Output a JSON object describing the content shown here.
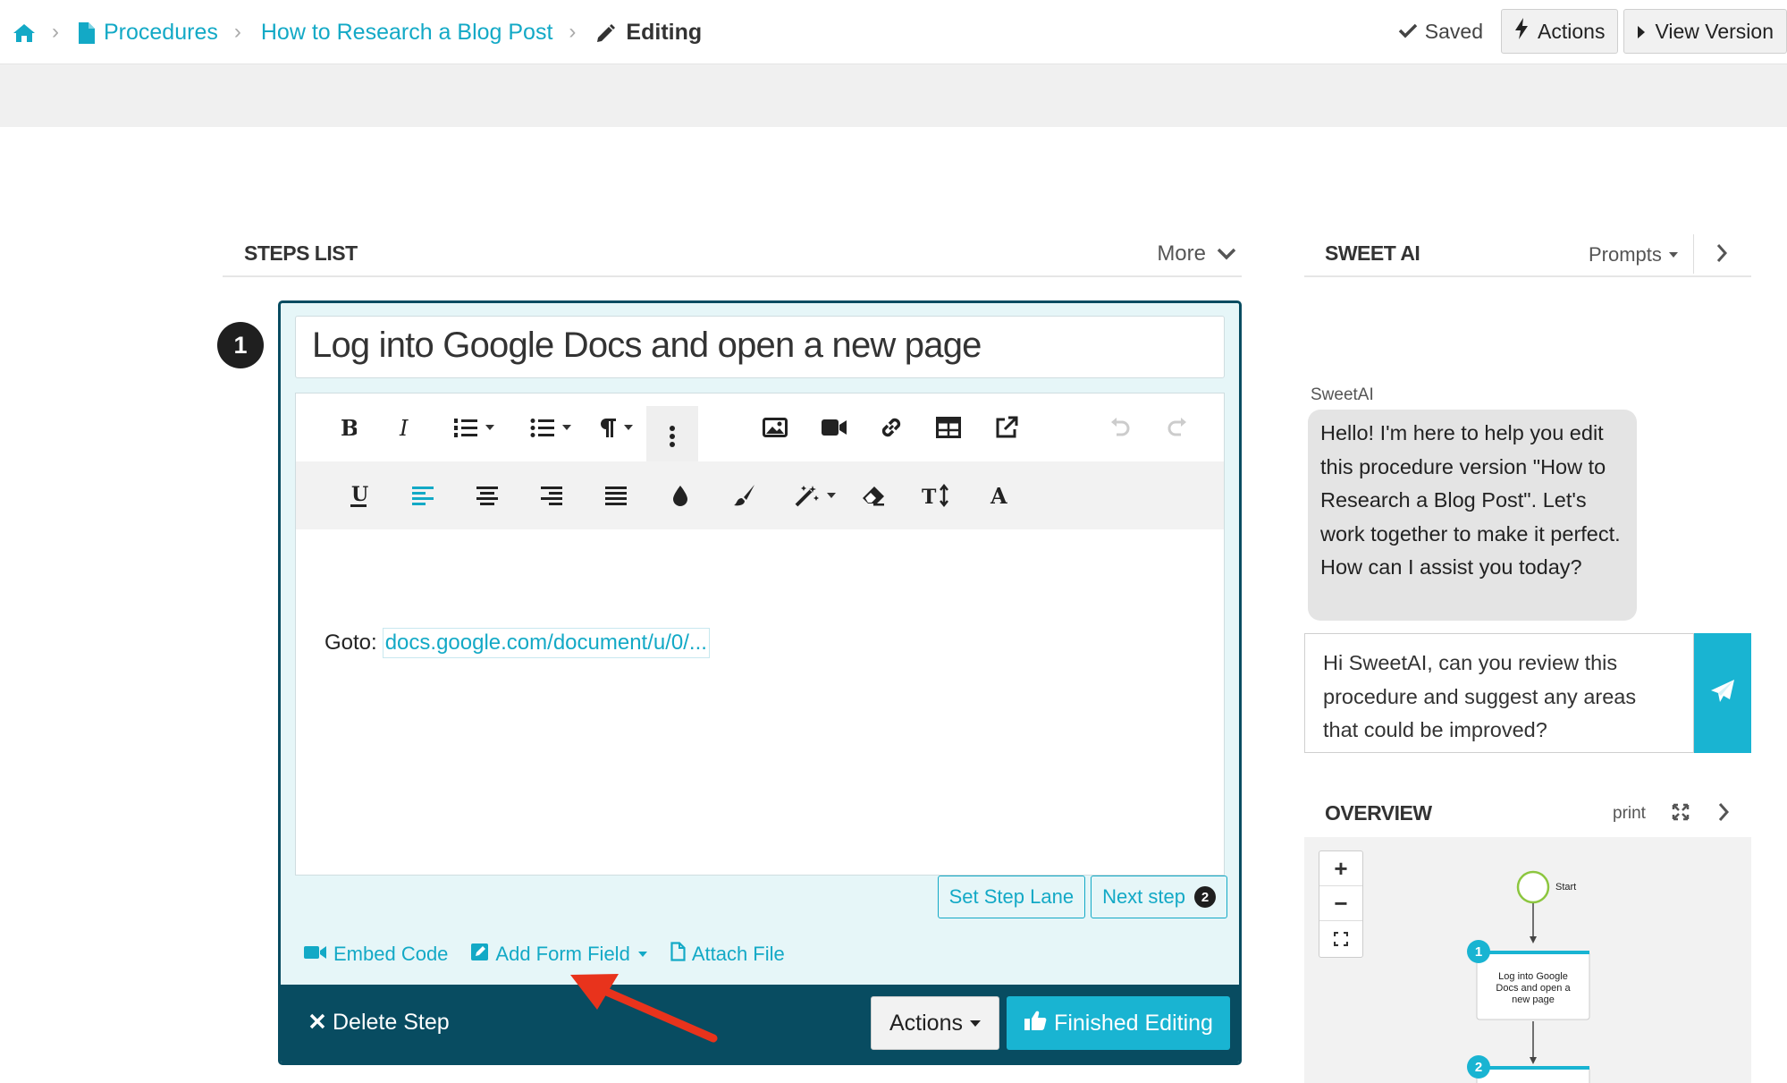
{
  "breadcrumb": {
    "home_icon": "home-icon",
    "procedures": "Procedures",
    "procedure_name": "How to Research a Blog Post",
    "current": "Editing"
  },
  "header": {
    "saved": "Saved",
    "actions": "Actions",
    "view_version": "View Version"
  },
  "steps_list": {
    "title": "STEPS LIST",
    "more": "More"
  },
  "step": {
    "number": "1",
    "title": "Log into Google Docs and open a new page",
    "content_prefix": "Goto:",
    "content_link": "docs.google.com/document/u/0/...",
    "set_step_lane": "Set Step Lane",
    "next_step": "Next step",
    "next_step_number": "2",
    "embed_code": "Embed Code",
    "add_form_field": "Add Form Field",
    "attach_file": "Attach File",
    "delete_step": "Delete Step",
    "actions": "Actions",
    "finished_editing": "Finished Editing"
  },
  "sweet_ai": {
    "title": "SWEET AI",
    "prompts": "Prompts",
    "sender": "SweetAI",
    "message": "Hello! I'm here to help you edit this procedure version \"How to Research a Blog Post\". Let's work together to make it perfect. How can I assist you today?",
    "input_value": "Hi SweetAI, can you review this procedure and suggest any areas that could be improved?"
  },
  "overview": {
    "title": "OVERVIEW",
    "print": "print",
    "start_label": "Start",
    "node1_number": "1",
    "node1_label_line1": "Log into Google",
    "node1_label_line2": "Docs and open a",
    "node1_label_line3": "new page",
    "node2_number": "2",
    "zoom_in": "+",
    "zoom_out": "−"
  },
  "colors": {
    "accent": "#13a9c6",
    "button_primary": "#19b4d2",
    "footer_dark": "#084c61",
    "card_bg": "#e6f6f8",
    "arrow": "#e8331c"
  }
}
